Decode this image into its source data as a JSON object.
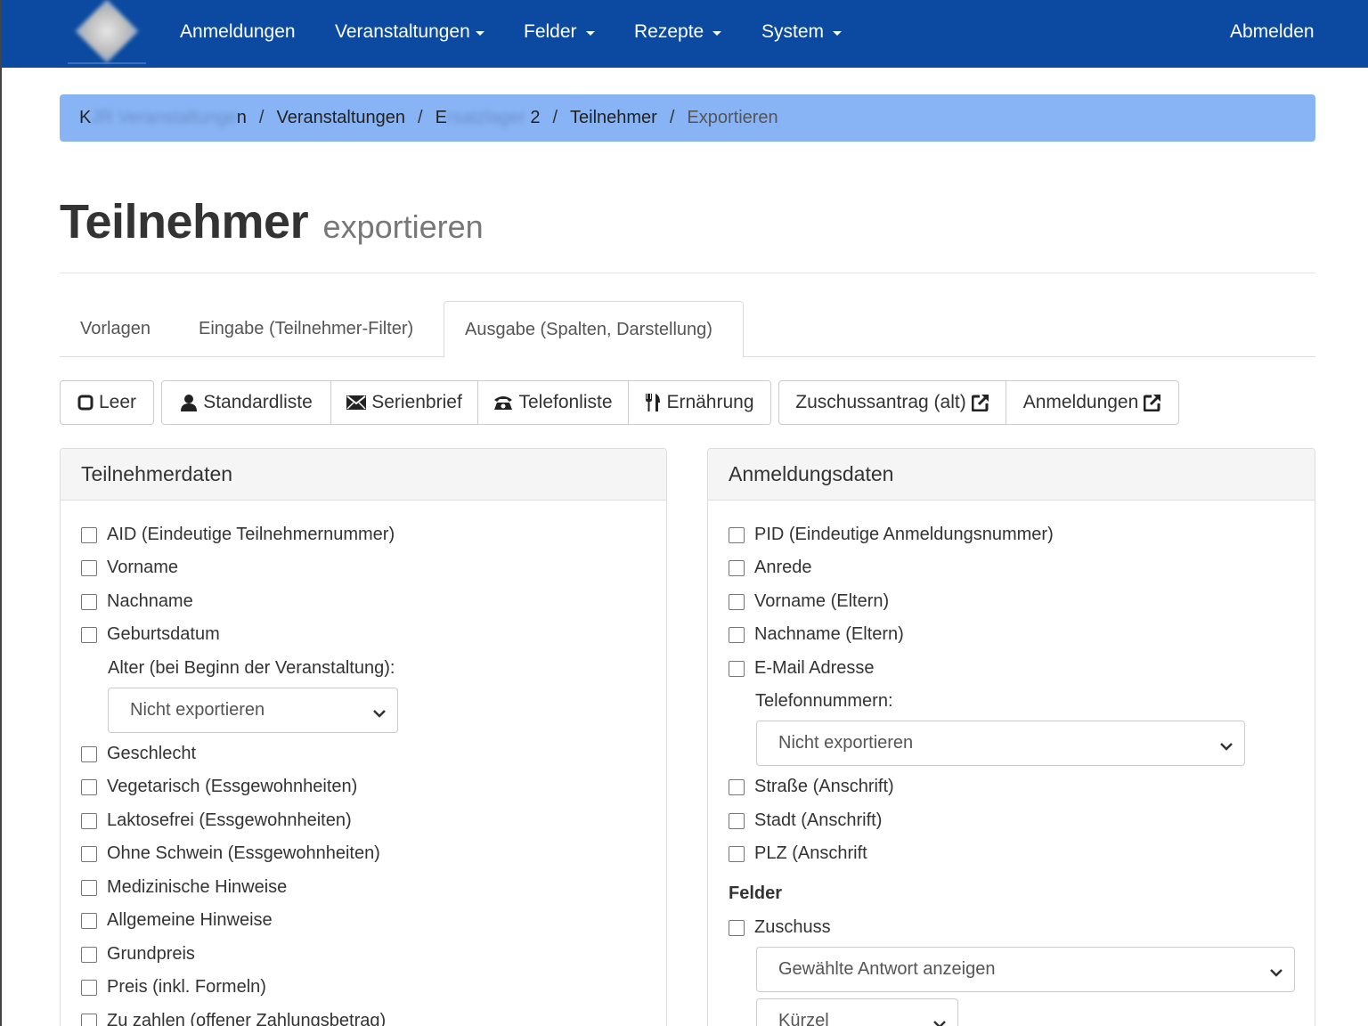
{
  "navbar": {
    "items": [
      {
        "label": "Anmeldungen"
      },
      {
        "label": "Veranstaltungen"
      },
      {
        "label": "Felder"
      },
      {
        "label": "Rezepte"
      },
      {
        "label": "System"
      }
    ],
    "logout": "Abmelden"
  },
  "breadcrumb": {
    "item1_start": "K",
    "item1_blurred": "JR Veranstaltunge",
    "item1_end": "n",
    "item2": "Veranstaltungen",
    "item3_start": "E",
    "item3_blurred": "rsatzlager",
    "item3_end": "2",
    "item4": "Teilnehmer",
    "active": "Exportieren",
    "separator": "/"
  },
  "page": {
    "title": "Teilnehmer",
    "subtitle": "exportieren"
  },
  "tabs": [
    {
      "label": "Vorlagen"
    },
    {
      "label": "Eingabe (Teilnehmer-Filter)"
    },
    {
      "label": "Ausgabe (Spalten, Darstellung)"
    }
  ],
  "toolbar": {
    "leer": "Leer",
    "standardliste": "Standardliste",
    "serienbrief": "Serienbrief",
    "telefonliste": "Telefonliste",
    "ernaehrung": "Ernährung",
    "zuschussantrag": "Zuschussantrag (alt)",
    "anmeldungen": "Anmeldungen"
  },
  "teilnehmerdaten": {
    "heading": "Teilnehmerdaten",
    "items_top": [
      "AID (Eindeutige Teilnehmernummer)",
      "Vorname",
      "Nachname",
      "Geburtsdatum"
    ],
    "alter_label": "Alter (bei Beginn der Veranstaltung):",
    "alter_select": "Nicht exportieren",
    "items_bottom": [
      "Geschlecht",
      "Vegetarisch (Essgewohnheiten)",
      "Laktosefrei (Essgewohnheiten)",
      "Ohne Schwein (Essgewohnheiten)",
      "Medizinische Hinweise",
      "Allgemeine Hinweise",
      "Grundpreis",
      "Preis (inkl. Formeln)",
      "Zu zahlen (offener Zahlungsbetrag)"
    ]
  },
  "anmeldungsdaten": {
    "heading": "Anmeldungsdaten",
    "items_top": [
      "PID (Eindeutige Anmeldungsnummer)",
      "Anrede",
      "Vorname (Eltern)",
      "Nachname (Eltern)",
      "E-Mail Adresse"
    ],
    "telefon_label": "Telefonnummern:",
    "telefon_select": "Nicht exportieren",
    "items_bottom": [
      "Straße (Anschrift)",
      "Stadt (Anschrift)",
      "PLZ (Anschrift"
    ],
    "felder_label": "Felder",
    "zuschuss": "Zuschuss",
    "zuschuss_select": "Gewählte Antwort anzeigen",
    "kuerzel_select": "Kürzel"
  }
}
